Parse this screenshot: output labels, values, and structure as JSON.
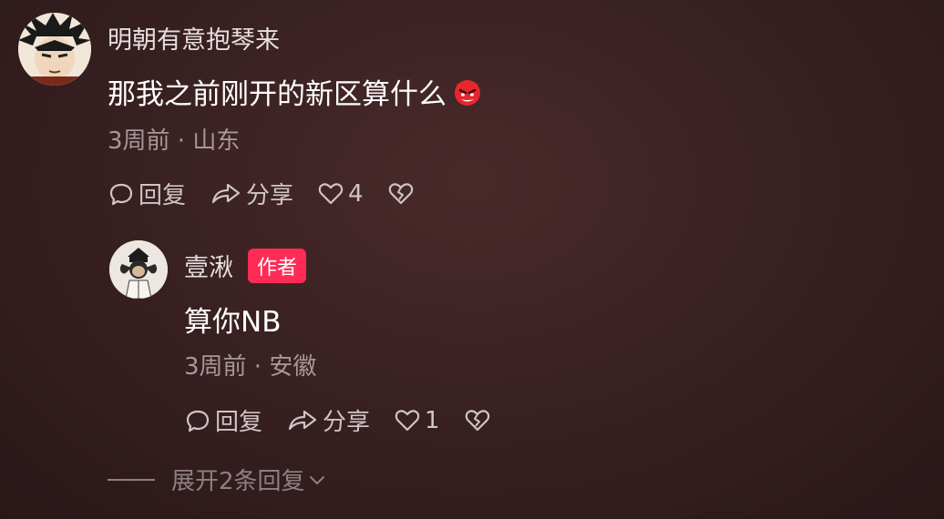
{
  "comment": {
    "username": "明朝有意抱琴来",
    "text": "那我之前刚开的新区算什么",
    "emoji": "angry-devil-emoji",
    "meta": "3周前 · 山东",
    "reply_label": "回复",
    "share_label": "分享",
    "like_count": "4"
  },
  "reply": {
    "username": "壹湫",
    "badge": "作者",
    "text": "算你NB",
    "meta": "3周前 · 安徽",
    "reply_label": "回复",
    "share_label": "分享",
    "like_count": "1"
  },
  "expand": {
    "label": "展开2条回复"
  },
  "colors": {
    "badge": "#fe2c55",
    "emoji": "#e8262f"
  }
}
